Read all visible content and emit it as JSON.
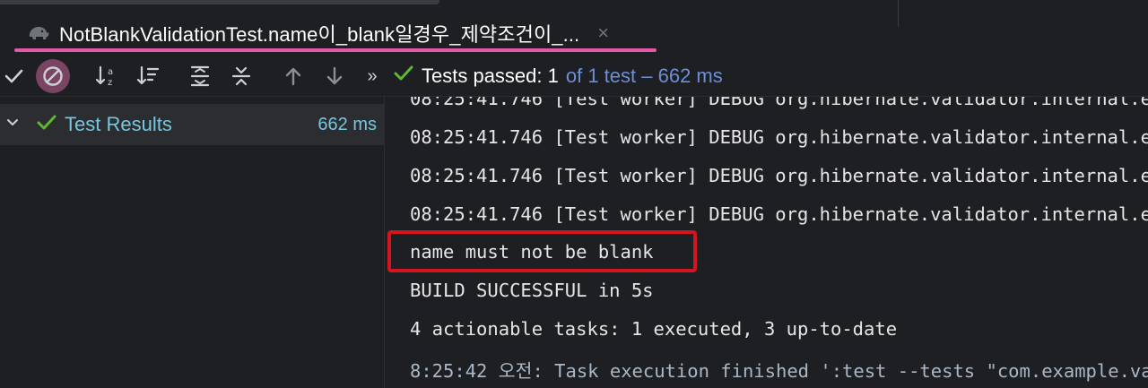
{
  "tab": {
    "title": "NotBlankValidationTest.name이_blank일경우_제약조건이_...",
    "close": "×",
    "icon": "gradle-elephant-icon"
  },
  "toolbar": {
    "icons": [
      "check-icon",
      "stop-icon",
      "sort-alpha-icon",
      "sort-duration-icon",
      "expand-all-icon",
      "collapse-all-icon",
      "arrow-up-icon",
      "arrow-down-icon",
      "more-icon"
    ],
    "more_label": "»",
    "status_passed": "Tests passed: 1",
    "status_detail": "of 1 test – 662 ms"
  },
  "tree": {
    "root_label": "Test Results",
    "root_time": "662 ms"
  },
  "console": {
    "lines": [
      "08:25:41.746 [Test worker] DEBUG org.hibernate.validator.internal.e",
      "08:25:41.746 [Test worker] DEBUG org.hibernate.validator.internal.e",
      "08:25:41.746 [Test worker] DEBUG org.hibernate.validator.internal.e",
      "08:25:41.746 [Test worker] DEBUG org.hibernate.validator.internal.e",
      "name must not be blank",
      "BUILD SUCCESSFUL in 5s",
      "4 actionable tasks: 1 executed, 3 up-to-date",
      "8:25:42 오전: Task execution finished ':test --tests \"com.example.va"
    ],
    "highlighted_line": "name must not be blank"
  },
  "colors": {
    "accent_pink": "#e25aa7",
    "pass_green": "#5fb832",
    "link_blue": "#6d8fd6",
    "tree_cyan": "#75c7df",
    "highlight_red": "#d4141e"
  }
}
